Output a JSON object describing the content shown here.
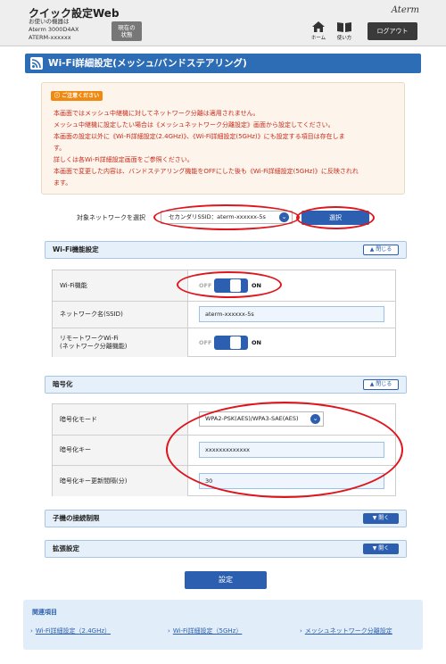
{
  "header": {
    "app_title": "クイック設定Web",
    "device_label_1": "お使いの機器は",
    "device_label_2": "Aterm 3000D4AX",
    "device_label_3": "ATERM-xxxxxx",
    "status_btn_1": "現在の",
    "status_btn_2": "状態",
    "brand": "Aterm",
    "home_label": "ホーム",
    "help_label": "使い方",
    "logout_label": "ログアウト"
  },
  "page": {
    "title": "Wi-Fi詳細設定(メッシュ/バンドステアリング)"
  },
  "caution": {
    "badge": "ご注意ください",
    "lines": [
      "本画面ではメッシュ中継機に対してネットワーク分離は適用されません。",
      "メッシュ中継機に設定したい場合は《メッシュネットワーク分離設定》画面から設定してください。",
      "本画面の設定以外に《Wi-Fi詳細設定(2.4GHz)》、《Wi-Fi詳細設定(5GHz)》にも設定する項目は存在しま",
      "す。",
      "詳しくは各Wi-Fi詳細設定画面をご参照ください。",
      "本画面で変更した内容は、バンドステアリング機能をOFFにした後も《Wi-Fi詳細設定(5GHz)》に反映されれ",
      "ます。"
    ]
  },
  "target": {
    "label": "対象ネットワークを選択",
    "selected": "セカンダリSSID：aterm-xxxxxx-5s",
    "select_button": "選択"
  },
  "wifi_section": {
    "title": "Wi-Fi機能設定",
    "close_label": "閉じる",
    "rows": {
      "wifi_function_label": "Wi-Fi機能",
      "ssid_label": "ネットワーク名(SSID)",
      "ssid_value": "aterm-xxxxxx-5s",
      "remote_label_1": "リモートワークWi-Fi",
      "remote_label_2": "(ネットワーク分離機能)"
    },
    "toggle_off": "OFF",
    "toggle_on": "ON",
    "wifi_function_on": true,
    "remote_on": true
  },
  "enc_section": {
    "title": "暗号化",
    "close_label": "閉じる",
    "mode_label": "暗号化モード",
    "mode_value": "WPA2-PSK(AES)/WPA3-SAE(AES)",
    "key_label": "暗号化キー",
    "key_value": "xxxxxxxxxxxxx",
    "interval_label": "暗号化キー更新間隔(分)",
    "interval_value": "30"
  },
  "child_section": {
    "title": "子機の接続制限",
    "open_label": "開く"
  },
  "ext_section": {
    "title": "拡張設定",
    "open_label": "開く"
  },
  "set_button": "設定",
  "related": {
    "title": "関連項目",
    "links": [
      "Wi-Fi詳細設定（2.4GHz）",
      "Wi-Fi詳細設定（5GHz）",
      "メッシュネットワーク分離設定"
    ]
  },
  "colors": {
    "accent_blue": "#2d5fb0",
    "title_blue": "#2d6db5",
    "caution_red": "#c8291a",
    "annotation_red": "#e0141c"
  },
  "icons": [
    "wifi-icon",
    "home-icon",
    "book-icon",
    "chevron-down-icon",
    "chevron-up-icon",
    "arrow-right-icon"
  ]
}
